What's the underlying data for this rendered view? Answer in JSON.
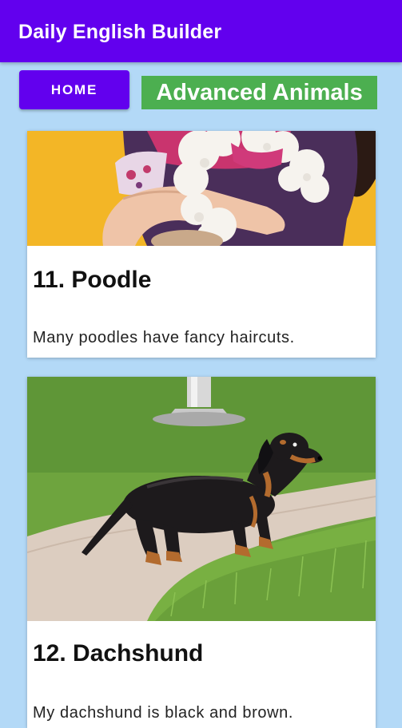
{
  "app_bar": {
    "title": "Daily English Builder"
  },
  "nav": {
    "home_label": "HOME",
    "category_label": "Advanced Animals"
  },
  "colors": {
    "primary": "#6200ee",
    "background": "#b3d9f7",
    "category_badge": "#4caf50"
  },
  "cards": [
    {
      "title": "11. Poodle",
      "description": "Many poodles have fancy haircuts.",
      "image_icon": "poodle-photo"
    },
    {
      "title": "12. Dachshund",
      "description": "My dachshund is black and brown.",
      "image_icon": "dachshund-photo"
    }
  ]
}
